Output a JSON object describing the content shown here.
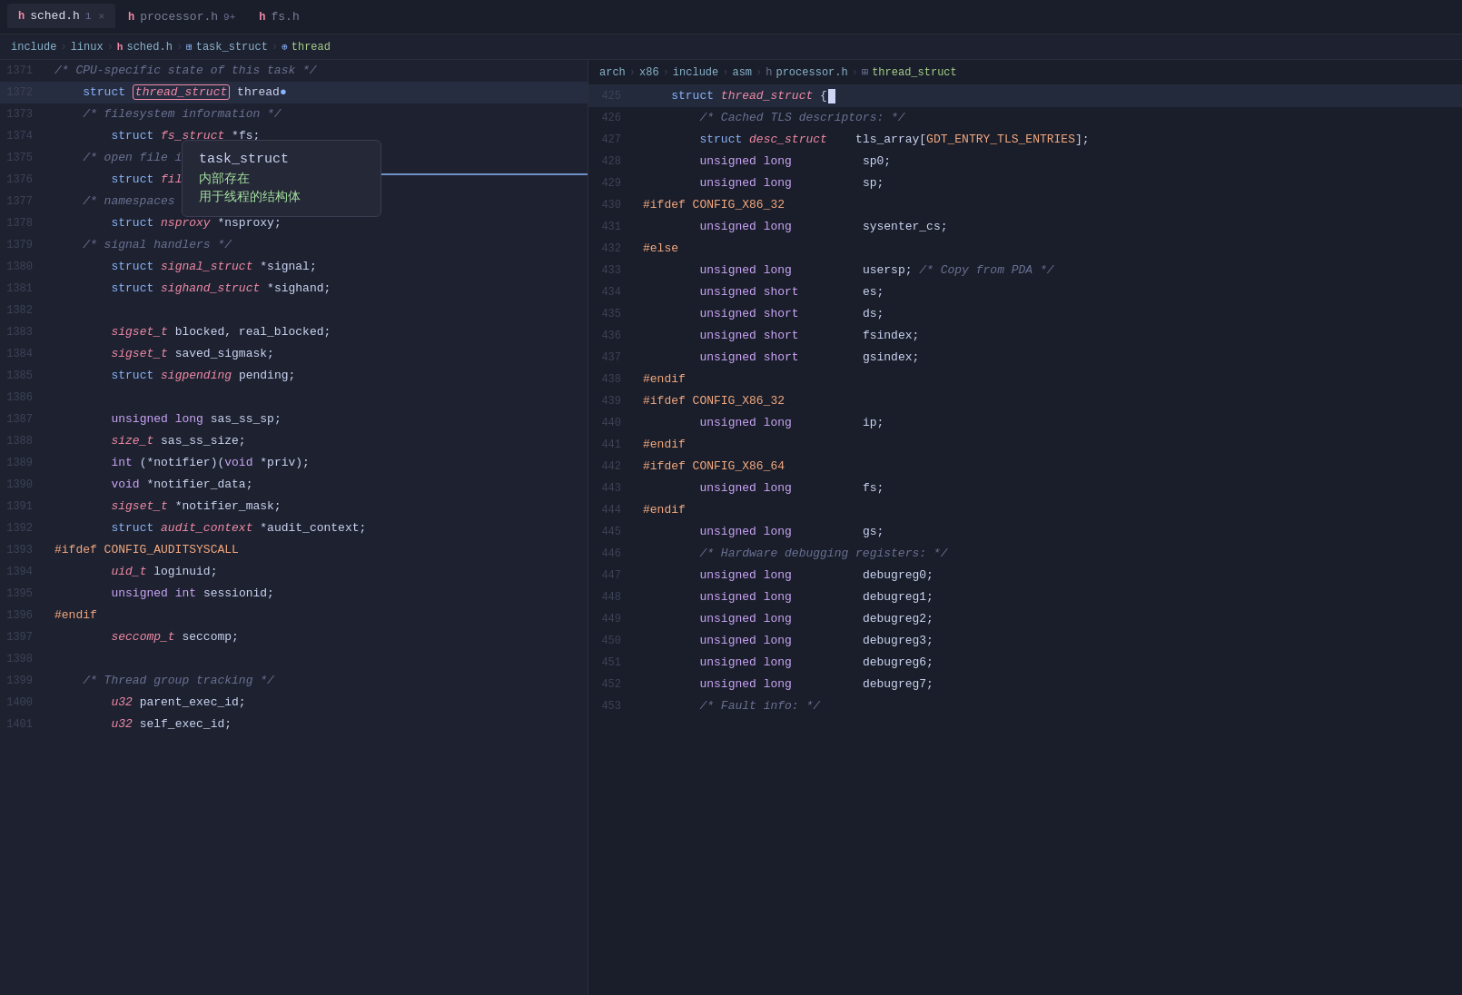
{
  "tabs": [
    {
      "id": "sched",
      "icon": "h",
      "label": "sched.h",
      "badge": "1",
      "active": true,
      "closeable": true
    },
    {
      "id": "processor",
      "icon": "h",
      "label": "processor.h",
      "badge": "9+",
      "active": false,
      "closeable": false
    },
    {
      "id": "fs",
      "icon": "h",
      "label": "fs.h",
      "active": false,
      "closeable": false
    }
  ],
  "left_breadcrumb": {
    "parts": [
      "include",
      "linux",
      "sched.h",
      "task_struct",
      "thread"
    ]
  },
  "right_breadcrumb": {
    "parts": [
      "arch",
      "x86",
      "include",
      "asm",
      "processor.h",
      "thread_struct"
    ]
  },
  "tooltip": {
    "title": "task_struct",
    "line1": "内部存在",
    "line2": "用于线程的结构体"
  },
  "left_lines": [
    {
      "num": "1371",
      "content": "/* CPU-specific state of this task */"
    },
    {
      "num": "1372",
      "content": "    struct thread_struct thread;",
      "highlight": true
    },
    {
      "num": "1373",
      "content": "    /* filesystem information */"
    },
    {
      "num": "1374",
      "content": "        struct fs_struct *fs;"
    },
    {
      "num": "1375",
      "content": "    /* open file information */"
    },
    {
      "num": "1376",
      "content": "        struct files_struct *files;"
    },
    {
      "num": "1377",
      "content": "    /* namespaces */"
    },
    {
      "num": "1378",
      "content": "        struct nsproxy *nsproxy;"
    },
    {
      "num": "1379",
      "content": "    /* signal handlers */"
    },
    {
      "num": "1380",
      "content": "        struct signal_struct *signal;"
    },
    {
      "num": "1381",
      "content": "        struct sighand_struct *sighand;"
    },
    {
      "num": "1382",
      "content": ""
    },
    {
      "num": "1383",
      "content": "        sigset_t blocked, real_blocked;"
    },
    {
      "num": "1384",
      "content": "        sigset_t saved_sigmask;"
    },
    {
      "num": "1385",
      "content": "        struct sigpending pending;"
    },
    {
      "num": "1386",
      "content": ""
    },
    {
      "num": "1387",
      "content": "        unsigned long sas_ss_sp;"
    },
    {
      "num": "1388",
      "content": "        size_t sas_ss_size;"
    },
    {
      "num": "1389",
      "content": "        int (*notifier)(void *priv);"
    },
    {
      "num": "1390",
      "content": "        void *notifier_data;"
    },
    {
      "num": "1391",
      "content": "        sigset_t *notifier_mask;"
    },
    {
      "num": "1392",
      "content": "        struct audit_context *audit_context;"
    },
    {
      "num": "1393",
      "content": "#ifdef CONFIG_AUDITSYSCALL"
    },
    {
      "num": "1394",
      "content": "        uid_t loginuid;"
    },
    {
      "num": "1395",
      "content": "        unsigned int sessionid;"
    },
    {
      "num": "1396",
      "content": "#endif"
    },
    {
      "num": "1397",
      "content": "        seccomp_t seccomp;"
    },
    {
      "num": "1398",
      "content": ""
    },
    {
      "num": "1399",
      "content": "    /* Thread group tracking */"
    },
    {
      "num": "1400",
      "content": "        u32 parent_exec_id;"
    },
    {
      "num": "1401",
      "content": "        u32 self_exec_id;"
    }
  ],
  "right_lines": [
    {
      "num": "425",
      "content": "    struct thread_struct {",
      "cursor": true
    },
    {
      "num": "426",
      "content": "        /* Cached TLS descriptors: */"
    },
    {
      "num": "427",
      "content": "        struct desc_struct    tls_array[GDT_ENTRY_TLS_ENTRIES];"
    },
    {
      "num": "428",
      "content": "        unsigned long          sp0;"
    },
    {
      "num": "429",
      "content": "        unsigned long          sp;"
    },
    {
      "num": "430",
      "content": "#ifdef CONFIG_X86_32"
    },
    {
      "num": "431",
      "content": "        unsigned long          sysenter_cs;"
    },
    {
      "num": "432",
      "content": "#else"
    },
    {
      "num": "433",
      "content": "        unsigned long          usersp; /* Copy from PDA */"
    },
    {
      "num": "434",
      "content": "        unsigned short         es;"
    },
    {
      "num": "435",
      "content": "        unsigned short         ds;"
    },
    {
      "num": "436",
      "content": "        unsigned short         fsindex;"
    },
    {
      "num": "437",
      "content": "        unsigned short         gsindex;"
    },
    {
      "num": "438",
      "content": "#endif"
    },
    {
      "num": "439",
      "content": "#ifdef CONFIG_X86_32"
    },
    {
      "num": "440",
      "content": "        unsigned long          ip;"
    },
    {
      "num": "441",
      "content": "#endif"
    },
    {
      "num": "442",
      "content": "#ifdef CONFIG_X86_64"
    },
    {
      "num": "443",
      "content": "        unsigned long          fs;"
    },
    {
      "num": "444",
      "content": "#endif"
    },
    {
      "num": "445",
      "content": "        unsigned long          gs;"
    },
    {
      "num": "446",
      "content": "        /* Hardware debugging registers: */"
    },
    {
      "num": "447",
      "content": "        unsigned long          debugreg0;"
    },
    {
      "num": "448",
      "content": "        unsigned long          debugreg1;"
    },
    {
      "num": "449",
      "content": "        unsigned long          debugreg2;"
    },
    {
      "num": "450",
      "content": "        unsigned long          debugreg3;"
    },
    {
      "num": "451",
      "content": "        unsigned long          debugreg6;"
    },
    {
      "num": "452",
      "content": "        unsigned long          debugreg7;"
    },
    {
      "num": "453",
      "content": "        /* Fault info: */"
    }
  ]
}
